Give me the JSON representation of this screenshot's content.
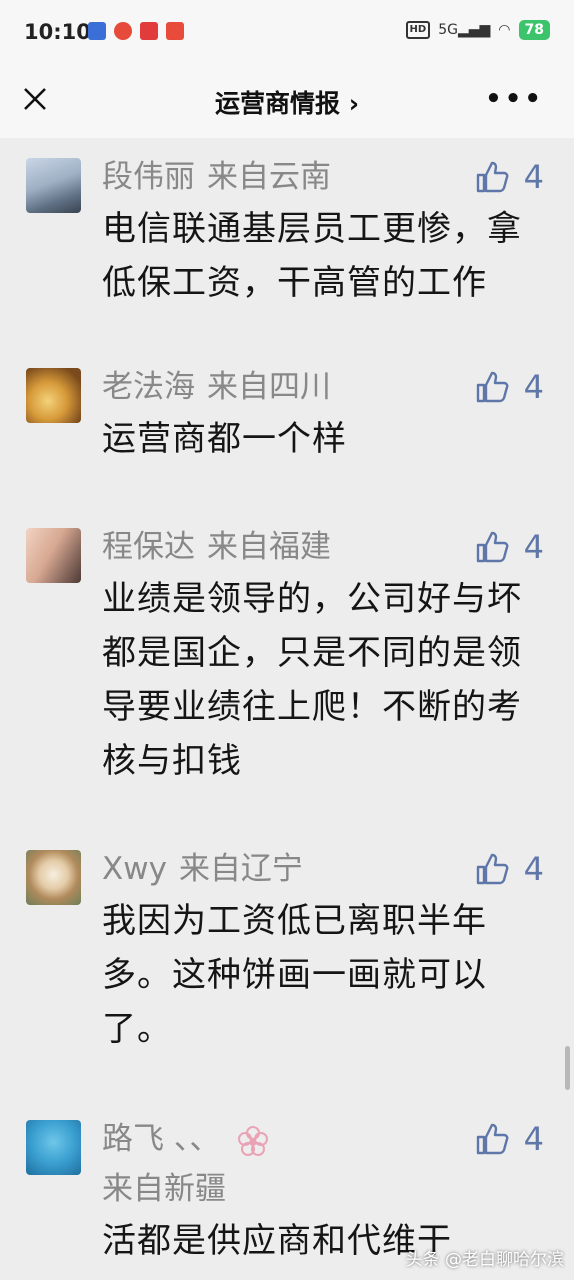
{
  "status_bar": {
    "time": "10:10",
    "network": "5G",
    "battery": "78"
  },
  "nav": {
    "title": "运营商情报 ›"
  },
  "comments": [
    {
      "name": "段伟丽",
      "location": "来自云南",
      "likes": "4",
      "text": "电信联通基层员工更惨，拿低保工资，干高管的工作"
    },
    {
      "name": "老法海",
      "location": "来自四川",
      "likes": "4",
      "text": "运营商都一个样"
    },
    {
      "name": "程保达",
      "location": "来自福建",
      "likes": "4",
      "text": "业绩是领导的，公司好与坏都是国企，只是不同的是领导要业绩往上爬！不断的考核与扣钱"
    },
    {
      "name": "Xwy",
      "location": "来自辽宁",
      "likes": "4",
      "text": "我因为工资低已离职半年多。这种饼画一画就可以了。"
    },
    {
      "name": "路飞 、、",
      "location": "来自新疆",
      "likes": "4",
      "text": "活都是供应商和代维干"
    }
  ],
  "watermark": "头条 @老白聊哈尔滨",
  "colors": {
    "accent": "#5f77a8",
    "background": "#ededed",
    "meta": "#888888"
  }
}
